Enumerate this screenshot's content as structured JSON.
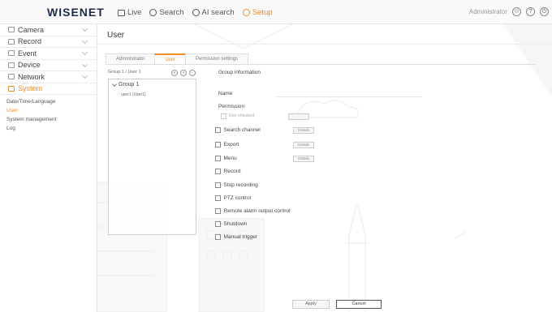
{
  "app": {
    "logo": "WISENET"
  },
  "nav": [
    {
      "label": "Live",
      "icon": "monitor-icon"
    },
    {
      "label": "Search",
      "icon": "search-icon"
    },
    {
      "label": "AI search",
      "icon": "ai-search-icon"
    },
    {
      "label": "Setup",
      "icon": "gear-icon",
      "active": true
    }
  ],
  "topright": {
    "user": "Administrator",
    "icons": [
      "user-icon",
      "help-icon",
      "power-icon"
    ]
  },
  "sidebar": {
    "items": [
      {
        "label": "Camera",
        "icon": "camera-icon"
      },
      {
        "label": "Record",
        "icon": "record-icon"
      },
      {
        "label": "Event",
        "icon": "event-icon"
      },
      {
        "label": "Device",
        "icon": "device-icon"
      },
      {
        "label": "Network",
        "icon": "network-icon"
      },
      {
        "label": "System",
        "icon": "system-icon",
        "active": true
      }
    ],
    "subitems": [
      {
        "label": "Date/Time/Language"
      },
      {
        "label": "User",
        "active": true
      },
      {
        "label": "System management"
      },
      {
        "label": "Log"
      }
    ]
  },
  "page": {
    "title": "User"
  },
  "tabs": [
    {
      "label": "Administrator"
    },
    {
      "label": "User",
      "active": true
    },
    {
      "label": "Permission settings"
    }
  ],
  "group_panel": {
    "header": "Group 1 / User 1",
    "group": "Group 1",
    "user": "user1 (User1)"
  },
  "group_info": {
    "title": "Group information",
    "name_label": "Name",
    "name_value": "",
    "permission_label": "Permission",
    "use_checked": "Use checked"
  },
  "permissions": [
    {
      "label": "Search channel",
      "button": "Details"
    },
    {
      "label": "Export",
      "button": "Details"
    },
    {
      "label": "Menu",
      "button": "Details"
    },
    {
      "label": "Record"
    },
    {
      "label": "Stop recording"
    },
    {
      "label": "PTZ control"
    },
    {
      "label": "Remote alarm output control"
    },
    {
      "label": "Shutdown"
    },
    {
      "label": "Manual trigger"
    }
  ],
  "buttons": {
    "apply": "Apply",
    "cancel": "Cancel"
  },
  "colors": {
    "accent": "#f08a24",
    "logo": "#1d2a4a"
  }
}
